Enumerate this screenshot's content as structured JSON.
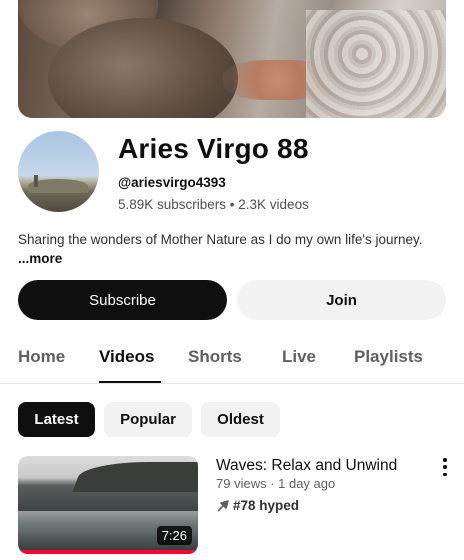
{
  "channel": {
    "name": "Aries Virgo 88",
    "handle": "@ariesvirgo4393",
    "stats": "5.89K subscribers • 2.3K videos",
    "description": "Sharing the wonders of Mother Nature as I do my own life's journey.",
    "more_label": "...more"
  },
  "actions": {
    "subscribe_label": "Subscribe",
    "join_label": "Join"
  },
  "tabs": [
    {
      "label": "Home",
      "active": false
    },
    {
      "label": "Videos",
      "active": true
    },
    {
      "label": "Shorts",
      "active": false
    },
    {
      "label": "Live",
      "active": false
    },
    {
      "label": "Playlists",
      "active": false
    }
  ],
  "chips": [
    {
      "label": "Latest",
      "active": true
    },
    {
      "label": "Popular",
      "active": false
    },
    {
      "label": "Oldest",
      "active": false
    }
  ],
  "videos": [
    {
      "title": "Waves: Relax and Unwind",
      "meta": "79 views · 1 day ago",
      "hype": "#78 hyped",
      "duration": "7:26"
    }
  ],
  "colors": {
    "accent": "#ff0033",
    "primary_text": "#0f0f0f",
    "secondary_text": "#606060",
    "chip_bg": "#f2f2f2"
  }
}
